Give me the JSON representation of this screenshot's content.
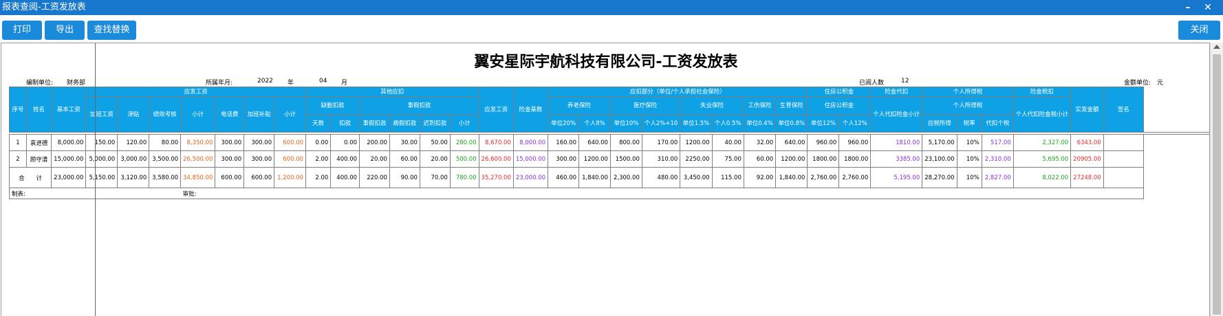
{
  "window": {
    "title": "报表查阅-工资发放表",
    "minimize_label": "–",
    "close_label": "✕"
  },
  "toolbar": {
    "print_label": "打印",
    "export_label": "导出",
    "find_replace_label": "查找替换",
    "close_label": "关闭"
  },
  "report": {
    "title": "翼安星际宇航科技有限公司-工资发放表",
    "org_label": "编制单位:",
    "org_value": "财务部",
    "period_label": "所属年月:",
    "year_value": "2022",
    "year_label": "年",
    "month_value": "04",
    "month_label": "月",
    "count_label": "已阅人数",
    "count_value": "12",
    "unit_label": "金额单位:",
    "unit_value": "元"
  },
  "headers": {
    "seq": "序号",
    "name": "姓名",
    "base_salary": "基本工资",
    "payable": "应发工资",
    "overtime_pay": "加班工资",
    "allowance": "津贴",
    "performance": "绩效考核",
    "subtotal": "小计",
    "phone_fee": "电话费",
    "overtime_subsidy": "加班补贴",
    "other_payable": "其他应扣",
    "absence_deduct": "缺勤扣款",
    "leave_deduct": "事假扣款",
    "days": "天数",
    "deduct": "扣款",
    "personal_leave": "事假扣款",
    "sick_leave": "病假扣款",
    "late_deduct": "迟到扣款",
    "gross_pay": "应发工资",
    "insurance_base": "险金基数",
    "social_insurance": "应扣部分（单位/个人承担社会保险）",
    "pension": "养老保险",
    "medical": "医疗保险",
    "unemployment": "失业保险",
    "injury": "工伤保险",
    "maternity": "生育保险",
    "housing_fund": "住房公积金",
    "housing_fund_sub": "住房公积金",
    "insurance_withhold": "险金代扣",
    "insurance_withhold_total": "个人代扣险金小计",
    "income_tax": "个人所得税",
    "income_tax_sub": "个人所得税",
    "taxable_income": "应税所得",
    "tax_rate": "税率",
    "tax_withheld": "代扣个税",
    "insurance_tax": "险金税扣",
    "insurance_tax_total": "个人代扣险金税小计",
    "net_pay": "实发金额",
    "signature": "签名",
    "unit_20": "单位20%",
    "personal_8": "个人8%",
    "unit_10": "单位10%",
    "personal_2_10": "个人2%+10",
    "unit_1_5": "单位1.5%",
    "personal_0_5": "个人0.5%",
    "unit_0_4": "单位0.4%",
    "unit_0_8": "单位0.8%",
    "unit_12": "单位12%",
    "personal_12": "个人12%"
  },
  "rows": [
    {
      "seq": "1",
      "name": "袁进德",
      "base": "8,000.00",
      "overtime": "150.00",
      "allowance": "120.00",
      "performance": "80.00",
      "subtotal1": "8,350.00",
      "phone": "300.00",
      "ot_subsidy": "300.00",
      "subtotal2": "600.00",
      "abs_days": "0.00",
      "abs_deduct": "0.00",
      "personal_leave": "200.00",
      "sick_leave": "30.00",
      "late": "50.00",
      "deduct_subtotal": "280.00",
      "gross": "8,670.00",
      "ins_base": "8,000.00",
      "pension_u": "160.00",
      "pension_p": "640.00",
      "medical_u": "800.00",
      "medical_p": "170.00",
      "unemp_u": "1200.00",
      "unemp_p": "40.00",
      "injury_u": "32.00",
      "maternity_u": "640.00",
      "hf_u": "960.00",
      "hf_p": "960.00",
      "ins_withhold_total": "1810.00",
      "taxable": "5,170.00",
      "tax_rate": "10%",
      "tax_withheld": "517.00",
      "ins_tax_total": "2,327.00",
      "net": "6343.00"
    },
    {
      "seq": "2",
      "name": "顾守清",
      "base": "15,000.00",
      "overtime": "5,000.00",
      "allowance": "3,000.00",
      "performance": "3,500.00",
      "subtotal1": "26,500.00",
      "phone": "300.00",
      "ot_subsidy": "300.00",
      "subtotal2": "600.00",
      "abs_days": "2.00",
      "abs_deduct": "400.00",
      "personal_leave": "20.00",
      "sick_leave": "60.00",
      "late": "20.00",
      "deduct_subtotal": "500.00",
      "gross": "26,600.00",
      "ins_base": "15,000.00",
      "pension_u": "300.00",
      "pension_p": "1200.00",
      "medical_u": "1500.00",
      "medical_p": "310.00",
      "unemp_u": "2250.00",
      "unemp_p": "75.00",
      "injury_u": "60.00",
      "maternity_u": "1200.00",
      "hf_u": "1800.00",
      "hf_p": "1800.00",
      "ins_withhold_total": "3385.00",
      "taxable": "23,100.00",
      "tax_rate": "10%",
      "tax_withheld": "2,310.00",
      "ins_tax_total": "5,695.00",
      "net": "20905.00"
    }
  ],
  "total": {
    "label": "合　　计",
    "base": "23,000.00",
    "overtime": "5,150.00",
    "allowance": "3,120.00",
    "performance": "3,580.00",
    "subtotal1": "34,850.00",
    "phone": "600.00",
    "ot_subsidy": "600.00",
    "subtotal2": "1,200.00",
    "abs_days": "2.00",
    "abs_deduct": "400.00",
    "personal_leave": "220.00",
    "sick_leave": "90.00",
    "late": "70.00",
    "deduct_subtotal": "780.00",
    "gross": "35,270.00",
    "ins_base": "23,000.00",
    "pension_u": "460.00",
    "pension_p": "1,840.00",
    "medical_u": "2,300.00",
    "medical_p": "480.00",
    "unemp_u": "3,450.00",
    "unemp_p": "115.00",
    "injury_u": "92.00",
    "maternity_u": "1,840.00",
    "hf_u": "2,760.00",
    "hf_p": "2,760.00",
    "ins_withhold_total": "5,195.00",
    "taxable": "28,270.00",
    "tax_rate": "10%",
    "tax_withheld": "2,827.00",
    "ins_tax_total": "8,022.00",
    "net": "27248.00"
  },
  "footer": {
    "maker_label": "制表:",
    "approve_label": "审批:"
  },
  "colors": {
    "titlebar": "#1677cc",
    "button": "#1a8adb",
    "header": "#0fa1e6",
    "orange": "#e8621a",
    "green": "#1ea31e",
    "red": "#e62828",
    "purple": "#8a2be2"
  }
}
